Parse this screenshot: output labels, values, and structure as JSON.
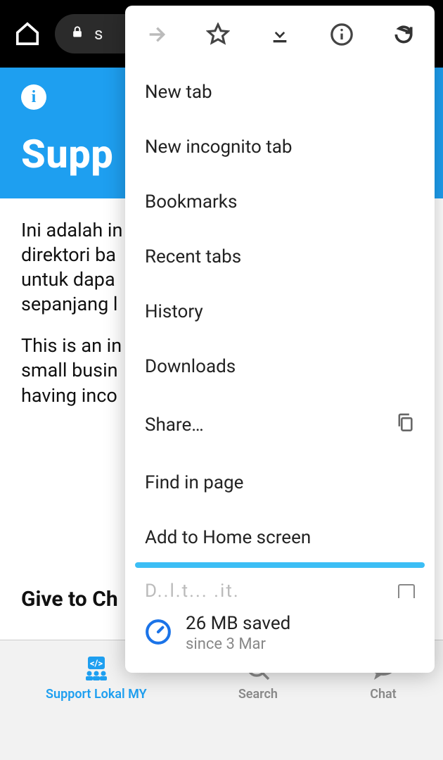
{
  "browser": {
    "url_display": "s",
    "home_icon": "home"
  },
  "page": {
    "title": "Supp",
    "paragraph1": "Ini adalah in\ndirektori ba\nuntuk dapa\nsepanjang l",
    "paragraph2": "This is an in\nsmall busin\nhaving inco",
    "section_heading": "Give to Ch"
  },
  "menu": {
    "icons": [
      "forward",
      "star",
      "download",
      "info",
      "reload"
    ],
    "items": {
      "new_tab": "New tab",
      "new_incognito": "New incognito tab",
      "bookmarks": "Bookmarks",
      "recent_tabs": "Recent tabs",
      "history": "History",
      "downloads": "Downloads",
      "share": "Share…",
      "find_in_page": "Find in page",
      "add_to_home": "Add to Home screen",
      "desktop_site_partial": "D··l·t···· ·it·"
    },
    "data_saver": {
      "line1": "26 MB saved",
      "line2": "since 3 Mar"
    }
  },
  "bottom_nav": {
    "item1": "Support Lokal MY",
    "item2": "Search",
    "item3": "Chat"
  }
}
